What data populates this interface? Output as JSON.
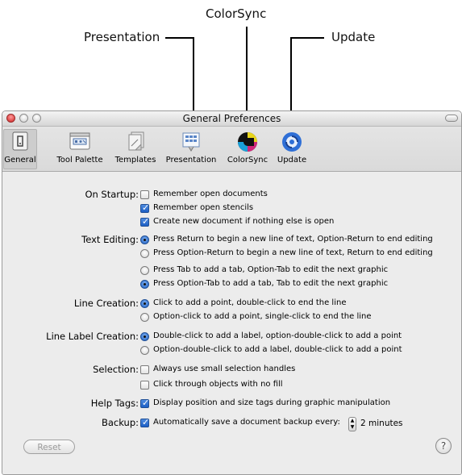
{
  "callouts": {
    "colorsync": "ColorSync",
    "presentation": "Presentation",
    "update": "Update"
  },
  "window": {
    "title": "General Preferences"
  },
  "toolbar": {
    "items": [
      {
        "label": "General",
        "icon": "general-icon",
        "selected": true
      },
      {
        "label": "Tool Palette",
        "icon": "tool-palette-icon"
      },
      {
        "label": "Templates",
        "icon": "templates-icon"
      },
      {
        "label": "Presentation",
        "icon": "presentation-icon"
      },
      {
        "label": "ColorSync",
        "icon": "colorsync-icon"
      },
      {
        "label": "Update",
        "icon": "update-icon"
      }
    ]
  },
  "settings": {
    "on_startup": {
      "label": "On Startup:",
      "options": [
        {
          "text": "Remember open documents",
          "checked": false
        },
        {
          "text": "Remember open stencils",
          "checked": true
        },
        {
          "text": "Create new document if nothing else is open",
          "checked": true
        }
      ]
    },
    "text_editing": {
      "label": "Text Editing:",
      "options": [
        {
          "text": "Press Return to begin a new line of text, Option-Return to end editing",
          "selected": true
        },
        {
          "text": "Press Option-Return to begin a new line of text, Return to end editing",
          "selected": false
        },
        {
          "text": "Press Tab to add a tab, Option-Tab to edit the next graphic",
          "selected": false
        },
        {
          "text": "Press Option-Tab to add a tab, Tab to edit the next graphic",
          "selected": true
        }
      ]
    },
    "line_creation": {
      "label": "Line Creation:",
      "options": [
        {
          "text": "Click to add a point, double-click to end the line",
          "selected": true
        },
        {
          "text": "Option-click to add a point, single-click to end the line",
          "selected": false
        }
      ]
    },
    "line_label_creation": {
      "label": "Line Label Creation:",
      "options": [
        {
          "text": "Double-click to add a label, option-double-click to add a point",
          "selected": true
        },
        {
          "text": "Option-double-click to add a label, double-click to add a point",
          "selected": false
        }
      ]
    },
    "selection": {
      "label": "Selection:",
      "options": [
        {
          "text": "Always use small selection handles",
          "checked": false
        },
        {
          "text": "Click through objects with no fill",
          "checked": false
        }
      ]
    },
    "help_tags": {
      "label": "Help Tags:",
      "options": [
        {
          "text": "Display position and size tags during graphic manipulation",
          "checked": true
        }
      ]
    },
    "backup": {
      "label": "Backup:",
      "option_text": "Automatically save a document backup every:",
      "checked": true,
      "value": "2 minutes"
    }
  },
  "footer": {
    "reset_label": "Reset",
    "help_label": "?"
  }
}
